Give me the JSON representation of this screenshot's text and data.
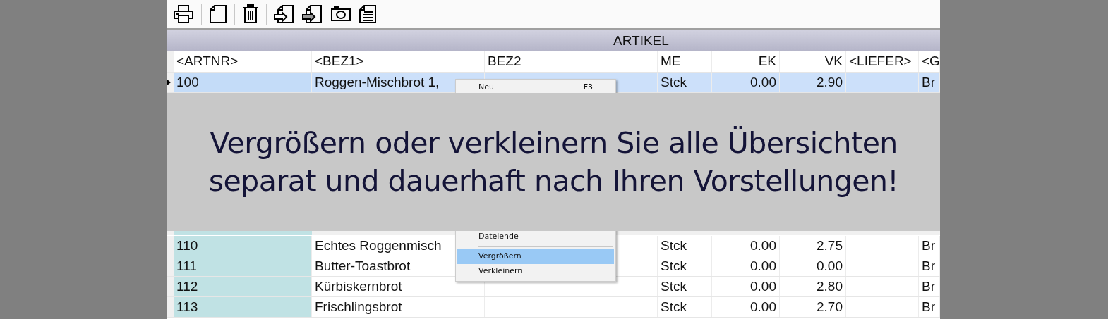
{
  "table": {
    "title": "ARTIKEL",
    "columns": [
      {
        "label": "<ARTNR>",
        "kind": "text"
      },
      {
        "label": "<BEZ1>",
        "kind": "text"
      },
      {
        "label": "BEZ2",
        "kind": "text"
      },
      {
        "label": "ME",
        "kind": "text"
      },
      {
        "label": "EK",
        "kind": "number"
      },
      {
        "label": "VK",
        "kind": "number"
      },
      {
        "label": "<LIEFER>",
        "kind": "text"
      },
      {
        "label": "<G",
        "kind": "text"
      }
    ],
    "rows_top": [
      {
        "selected": true,
        "cells": [
          "100",
          "Roggen-Mischbrot 1,",
          "",
          "Stck",
          "0.00",
          "2.90",
          "",
          "Br"
        ]
      }
    ],
    "rows_bottom": [
      {
        "selected": false,
        "cells": [
          "110",
          "Echtes Roggenmisch",
          "",
          "Stck",
          "0.00",
          "2.75",
          "",
          "Br"
        ]
      },
      {
        "selected": false,
        "cells": [
          "111",
          "Butter-Toastbrot",
          "",
          "Stck",
          "0.00",
          "0.00",
          "",
          "Br"
        ]
      },
      {
        "selected": false,
        "cells": [
          "112",
          "Kürbiskernbrot",
          "",
          "Stck",
          "0.00",
          "2.80",
          "",
          "Br"
        ]
      },
      {
        "selected": false,
        "cells": [
          "113",
          "Frischlingsbrot",
          "",
          "Stck",
          "0.00",
          "2.70",
          "",
          "Br"
        ]
      }
    ]
  },
  "banner": {
    "lines": [
      "Vergrößern oder verkleinern Sie alle Übersichten",
      "separat und dauerhaft nach Ihren Vorstellungen!"
    ]
  },
  "context_menu": {
    "items": [
      {
        "kind": "item",
        "label": "Neu",
        "shortcut": "F3",
        "selected": false
      },
      {
        "kind": "item",
        "label": "Dateiende",
        "selected": false
      },
      {
        "kind": "separator"
      },
      {
        "kind": "item",
        "label": "Vergrößern",
        "selected": true
      },
      {
        "kind": "item",
        "label": "Verkleinern",
        "selected": false
      }
    ]
  }
}
